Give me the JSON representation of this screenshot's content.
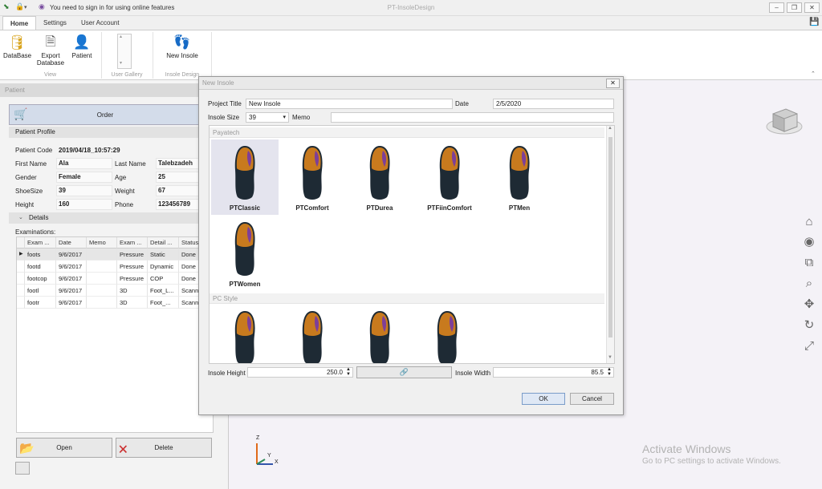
{
  "titlebar": {
    "app_title": "PT-InsoleDesign",
    "signin_notice": "You need to sign in for using online features"
  },
  "ribbon": {
    "tabs": [
      "Home",
      "Settings",
      "User Account"
    ],
    "buttons": {
      "database": "DataBase",
      "export_line1": "Export",
      "export_line2": "Database",
      "patient": "Patient",
      "new_insole": "New Insole"
    },
    "groups": {
      "view": "View",
      "gallery": "User Gallery",
      "design": "Insole Design"
    }
  },
  "patient": {
    "panel_title": "Patient",
    "order_label": "Order",
    "profile_title": "Patient Profile",
    "code_label": "Patient Code",
    "code": "2019/04/18_10:57:29",
    "first_name_label": "First Name",
    "first_name": "Ala",
    "last_name_label": "Last Name",
    "last_name": "Talebzadeh",
    "gender_label": "Gender",
    "gender": "Female",
    "age_label": "Age",
    "age": "25",
    "shoesize_label": "ShoeSize",
    "shoesize": "39",
    "weight_label": "Weight",
    "weight": "67",
    "height_label": "Height",
    "height": "160",
    "phone_label": "Phone",
    "phone": "123456789",
    "details_label": "Details",
    "examinations_label": "Examinations:",
    "columns": [
      "Exam ...",
      "Date",
      "Memo",
      "Exam ...",
      "Detail ...",
      "Status"
    ],
    "rows": [
      [
        "foots",
        "9/6/2017",
        "",
        "Pressure",
        "Static",
        "Done"
      ],
      [
        "footd",
        "9/6/2017",
        "",
        "Pressure",
        "Dynamic",
        "Done"
      ],
      [
        "footcop",
        "9/6/2017",
        "",
        "Pressure",
        "COP",
        "Done"
      ],
      [
        "footl",
        "9/6/2017",
        "",
        "3D",
        "Foot_L...",
        "Scann"
      ],
      [
        "footr",
        "9/6/2017",
        "",
        "3D",
        "Foot_...",
        "Scann"
      ]
    ],
    "open_label": "Open",
    "delete_label": "Delete"
  },
  "dialog": {
    "title": "New Insole",
    "project_title_label": "Project Title",
    "project_title": "New Insole",
    "date_label": "Date",
    "date": "2/5/2020",
    "insole_size_label": "Insole Size",
    "insole_size": "39",
    "memo_label": "Memo",
    "gallery_groups": [
      {
        "name": "Payatech",
        "items": [
          "PTClassic",
          "PTComfort",
          "PTDurea",
          "PTFiinComfort",
          "PTMen",
          "PTWomen"
        ]
      },
      {
        "name": "PC Style",
        "items": [
          "",
          "",
          "",
          ""
        ]
      }
    ],
    "insole_height_label": "Insole Height",
    "insole_height": "250.0",
    "insole_width_label": "Insole Width",
    "insole_width": "85.5",
    "ok_label": "OK",
    "cancel_label": "Cancel"
  },
  "watermark": {
    "line1": "Activate Windows",
    "line2": "Go to PC settings to activate Windows."
  },
  "axes": {
    "z": "Z",
    "y": "Y",
    "x": "X"
  },
  "colors": {
    "accent_blue": "#2b6fb6",
    "selection": "#e4e4ee"
  }
}
